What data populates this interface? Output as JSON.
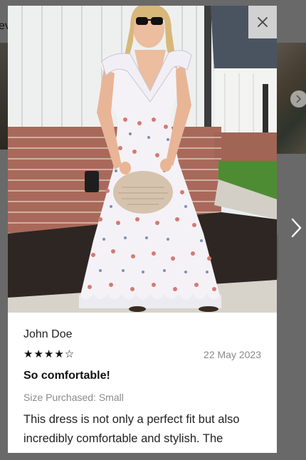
{
  "background": {
    "heading_fragment": "ev"
  },
  "review": {
    "author": "John Doe",
    "rating": 4,
    "rating_max": 5,
    "stars_text": "★★★★☆",
    "date": "22 May 2023",
    "title": "So comfortable!",
    "size_purchased": "Size Purchased: Small",
    "body": "This dress is not only a perfect fit but also incredibly comfortable and stylish. The lightweight pattern material is and looks"
  },
  "icons": {
    "close": "close-icon",
    "next": "chevron-right-icon",
    "carousel_next": "chevron-right-icon"
  },
  "colors": {
    "overlay": "#5d5d5d",
    "modal_bg": "#ffffff",
    "date_text": "#8a8a8a",
    "close_bg": "#dcdcdc"
  }
}
